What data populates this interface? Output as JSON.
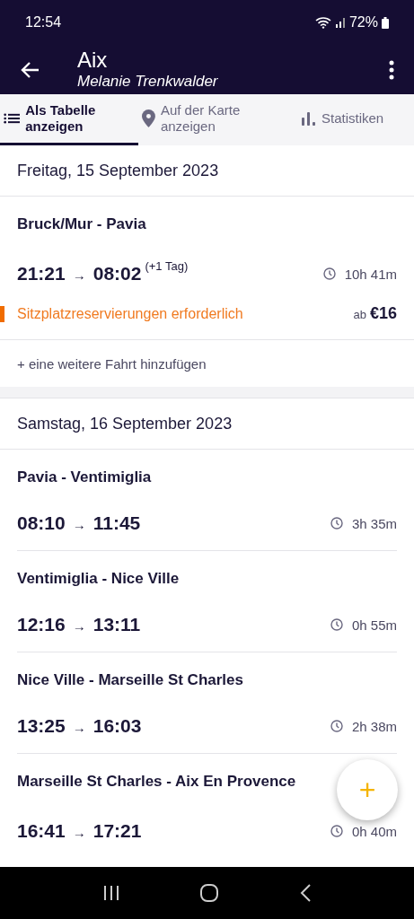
{
  "status_bar": {
    "time": "12:54",
    "battery": "72%"
  },
  "header": {
    "title": "Aix",
    "subtitle": "Melanie Trenkwalder"
  },
  "tabs": [
    {
      "label": "Als Tabelle anzeigen",
      "kind": "list",
      "selected": true
    },
    {
      "label": "Auf der Karte anzeigen",
      "kind": "map",
      "selected": false
    },
    {
      "label": "Statistiken",
      "kind": "stats",
      "selected": false
    }
  ],
  "days": [
    {
      "date": "Freitag, 15 September 2023",
      "legs": [
        {
          "route": "Bruck/Mur - Pavia",
          "departure": "21:21",
          "arrow": "→",
          "arrival": "08:02",
          "next_day": "(+1 Tag)",
          "duration": "10h 41m",
          "notice": "Sitzplatzreservierungen erforderlich",
          "price_prefix": "ab",
          "price": "€16"
        }
      ],
      "add_trip": "+ eine weitere Fahrt hinzufügen"
    },
    {
      "date": "Samstag, 16 September 2023",
      "legs": [
        {
          "route": "Pavia - Ventimiglia",
          "departure": "08:10",
          "arrow": "→",
          "arrival": "11:45",
          "duration": "3h 35m"
        },
        {
          "route": "Ventimiglia - Nice Ville",
          "departure": "12:16",
          "arrow": "→",
          "arrival": "13:11",
          "duration": "0h 55m"
        },
        {
          "route": "Nice Ville - Marseille St Charles",
          "departure": "13:25",
          "arrow": "→",
          "arrival": "16:03",
          "duration": "2h 38m"
        },
        {
          "route": "Marseille St Charles - Aix En Provence",
          "departure": "16:41",
          "arrow": "→",
          "arrival": "17:21",
          "duration": "0h 40m"
        }
      ]
    }
  ],
  "fab": {
    "label": "+"
  }
}
